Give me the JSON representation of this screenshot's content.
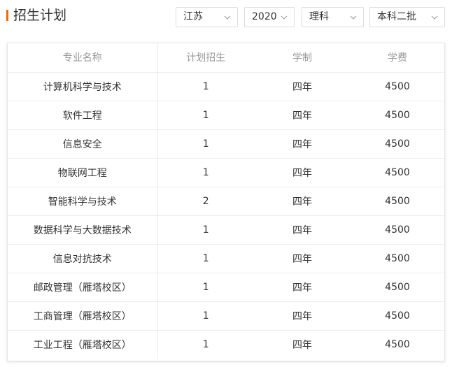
{
  "header": {
    "title": "招生计划"
  },
  "filters": {
    "province": "江苏",
    "year": "2020",
    "subject_type": "理科",
    "batch": "本科二批"
  },
  "icons": {
    "dropdown": "chevron-down-icon"
  },
  "colors": {
    "accent": "#f06a00",
    "header_text": "#999999",
    "border": "#ececec"
  },
  "table": {
    "columns": [
      "专业名称",
      "计划招生",
      "学制",
      "学费"
    ],
    "rows": [
      [
        "计算机科学与技术",
        "1",
        "四年",
        "4500"
      ],
      [
        "软件工程",
        "1",
        "四年",
        "4500"
      ],
      [
        "信息安全",
        "1",
        "四年",
        "4500"
      ],
      [
        "物联网工程",
        "1",
        "四年",
        "4500"
      ],
      [
        "智能科学与技术",
        "2",
        "四年",
        "4500"
      ],
      [
        "数据科学与大数据技术",
        "1",
        "四年",
        "4500"
      ],
      [
        "信息对抗技术",
        "1",
        "四年",
        "4500"
      ],
      [
        "邮政管理（雁塔校区）",
        "1",
        "四年",
        "4500"
      ],
      [
        "工商管理（雁塔校区）",
        "1",
        "四年",
        "4500"
      ],
      [
        "工业工程（雁塔校区）",
        "1",
        "四年",
        "4500"
      ]
    ]
  }
}
